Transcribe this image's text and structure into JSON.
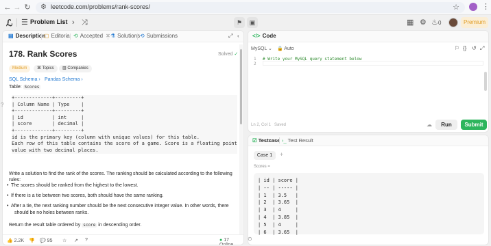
{
  "browser": {
    "url": "leetcode.com/problems/rank-scores/"
  },
  "topbar": {
    "problem_list": "Problem List",
    "notifications": "0",
    "premium": "Premium"
  },
  "tabs": {
    "description": "Description",
    "editorial": "Editorial",
    "accepted": "Accepted",
    "solutions": "Solutions",
    "submissions": "Submissions"
  },
  "problem": {
    "title": "178. Rank Scores",
    "status": "Solved",
    "difficulty": "Medium",
    "topics": "Topics",
    "companies": "Companies",
    "sql_schema": "SQL Schema",
    "pandas_schema": "Pandas Schema",
    "table_label": "Table:",
    "table_name": "Scores",
    "schema_text": "+-------------+---------+\n| Column Name | Type    |\n+-------------+---------+\n| id          | int     |\n| score       | decimal |\n+-------------+---------+\nid is the primary key (column with unique values) for this table.\nEach row of this table contains the score of a game. Score is a floating point\nvalue with two decimal places.",
    "instruction": "Write a solution to find the rank of the scores. The ranking should be calculated according to the following rules:",
    "rules": [
      "The scores should be ranked from the highest to the lowest.",
      "If there is a tie between two scores, both should have the same ranking.",
      "After a tie, the next ranking number should be the next consecutive integer value. In other words, there",
      "should be no holes between ranks."
    ],
    "return_prefix": "Return the result table ordered by",
    "return_code": "score",
    "return_suffix": "in descending order."
  },
  "footer": {
    "likes": "2.2K",
    "comments": "95",
    "online": "17 Online"
  },
  "editor": {
    "label": "Code",
    "language": "MySQL",
    "mode": "Auto",
    "line1": "1",
    "line2": "2",
    "comment": "# Write your MySQL query statement below",
    "position": "Ln 2, Col 1",
    "saved": "Saved",
    "run": "Run",
    "submit": "Submit"
  },
  "testpanel": {
    "testcase_tab": "Testcase",
    "result_tab": "Test Result",
    "case": "Case 1",
    "input_label": "Scores =",
    "input_table": "| id | score |\n| -- | ----- |\n| 1  | 3.5   |\n| 2  | 3.65  |\n| 3  | 4     |\n| 4  | 3.85  |\n| 5  | 4     |\n| 6  | 3.65  |"
  },
  "colors": {
    "green": "#2db55d",
    "premium": "#e09c25",
    "link": "#1f77d1"
  }
}
